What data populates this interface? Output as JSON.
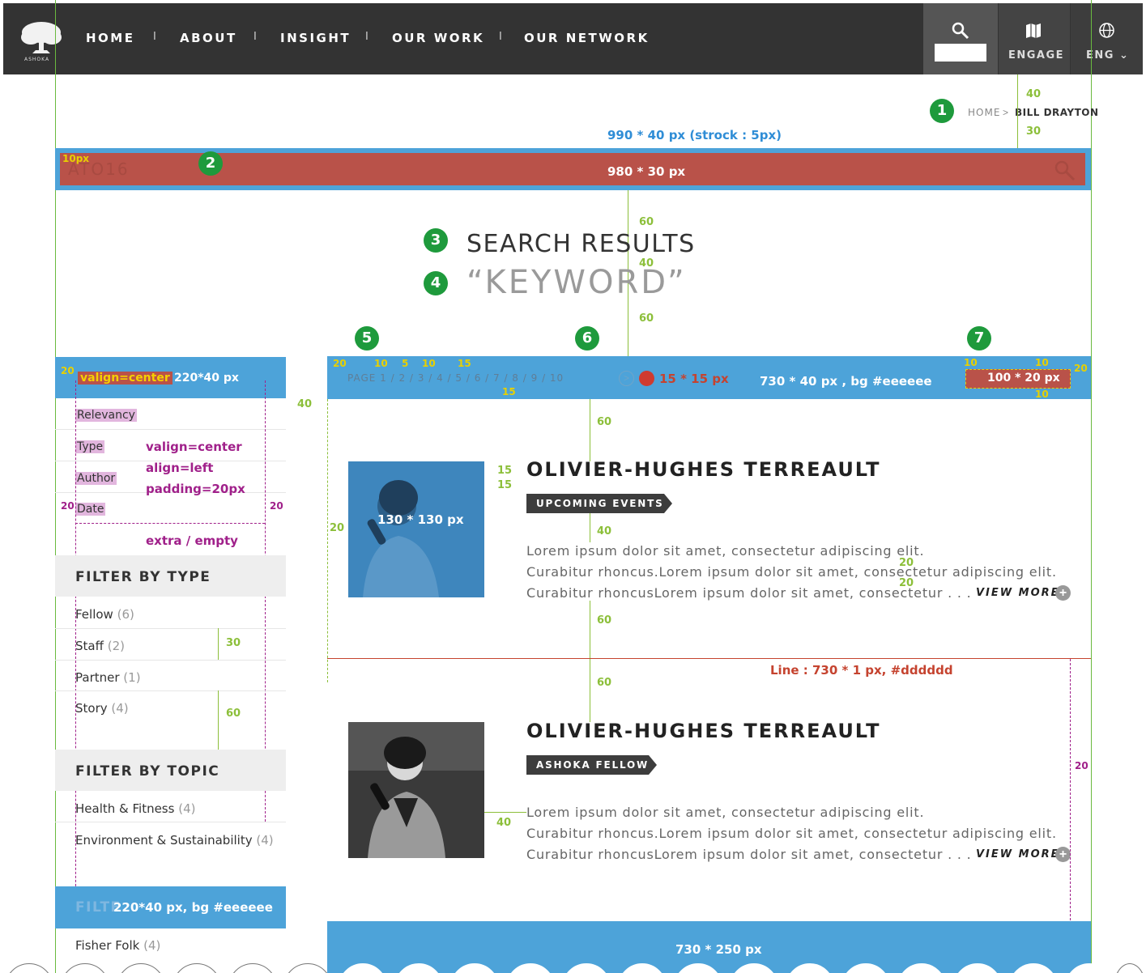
{
  "header": {
    "logo_text": "ASHOKA",
    "nav": [
      "HOME",
      "ABOUT",
      "INSIGHT",
      "OUR WORK",
      "OUR NETWORK"
    ],
    "separator": "I",
    "engage_label": "ENGAGE",
    "lang_label": "ENG"
  },
  "breadcrumb": {
    "home": "HOME",
    "sep": ">",
    "current": "BILL DRAYTON"
  },
  "search": {
    "value": "ATO16"
  },
  "titles": {
    "results": "SEARCH RESULTS",
    "keyword": "“KEYWORD”"
  },
  "badges": [
    "1",
    "2",
    "3",
    "4",
    "5",
    "6",
    "7"
  ],
  "spec_notes": {
    "search_outer": "990 * 40 px (strock : 5px)",
    "search_inner": "980 * 30 px",
    "search_pad": "10px",
    "sidebar_head_valign": "valign=center",
    "sidebar_head_size": "220*40 px",
    "sidebar_rows": [
      "valign=center",
      "align=left",
      "padding=20px"
    ],
    "sidebar_extra": "extra / empty",
    "page_dot": "15 * 15 px",
    "toolbar_size": "730 * 40 px , bg #eeeeee",
    "sort_size": "100 * 20 px",
    "photo_size": "130 * 130 px",
    "line_note": "Line : 730 * 1 px, #dddddd",
    "filter_hover": "220*40 px, bg #eeeeee",
    "bottom_block": "730 * 250 px"
  },
  "spacing": {
    "header_to_bc": "40",
    "bc_to_search": "30",
    "search_to_title": "60",
    "title_gap": "40",
    "title_to_list": "60",
    "sidebar_gap": "40",
    "toolbar_left": "20",
    "pager_gaps": [
      "10",
      "5",
      "10",
      "15"
    ],
    "toolbar_bottom": "15",
    "sort_top": "10",
    "sort_bottom": "10",
    "sort_left": "10",
    "sort_right": "20",
    "sidebar_head_left": "20",
    "card_top": "60",
    "title_gaps": [
      "15",
      "15"
    ],
    "tag_to_text": "40",
    "line_gaps": [
      "20",
      "20"
    ],
    "card_bottom": "60",
    "card2_top": "60",
    "photo_left": "20",
    "text_left2": "40",
    "row_30": "30",
    "row_60": "60",
    "side_20a": "20",
    "side_20b": "20",
    "right_20": "20"
  },
  "sidebar": {
    "sort": [
      "Relevancy",
      "Type",
      "Author",
      "Date"
    ],
    "filter_type": {
      "title": "FILTER BY TYPE",
      "items": [
        {
          "label": "Fellow",
          "count": "(6)"
        },
        {
          "label": "Staff",
          "count": "(2)"
        },
        {
          "label": "Partner",
          "count": "(1)"
        },
        {
          "label": "Story",
          "count": "(4)"
        }
      ]
    },
    "filter_topic": {
      "title": "FILTER BY TOPIC",
      "items": [
        {
          "label": "Health & Fitness",
          "count": "(4)"
        },
        {
          "label": "Environment & Sustainability",
          "count": "(4)"
        }
      ]
    },
    "filter_hover_label": "FILTE",
    "filter_more": [
      {
        "label": "Fisher Folk",
        "count": "(4)"
      }
    ]
  },
  "pager": {
    "text": "PAGE    1 / 2 / 3 / 4 / 5 / 6 / 7 / 8 / 9 / 10",
    "next": ">"
  },
  "results": [
    {
      "name": "OLIVIER-HUGHES TERREAULT",
      "tag": "UPCOMING EVENTS",
      "lines": [
        "Lorem ipsum dolor sit amet, consectetur adipiscing elit.",
        "Curabitur  rhoncus.Lorem  ipsum  dolor  sit  amet,  consectetur  adipiscing  elit.",
        "Curabitur rhoncusLorem ipsum dolor sit amet, consectetur . . ."
      ],
      "view_more": "VIEW MORE"
    },
    {
      "name": "OLIVIER-HUGHES TERREAULT",
      "tag": "ASHOKA FELLOW",
      "lines": [
        "Lorem ipsum dolor sit amet, consectetur adipiscing elit.",
        "Curabitur  rhoncus.Lorem  ipsum  dolor  sit  amet,  consectetur  adipiscing  elit.",
        "Curabitur rhoncusLorem ipsum dolor sit amet, consectetur . . ."
      ],
      "view_more": "VIEW MORE"
    }
  ],
  "colors": {
    "nav_bg": "#333333",
    "annotation_blue": "#4da3d9",
    "search_red": "#b95249",
    "badge_green": "#1e9a3c",
    "filter_bg": "#eeeeee",
    "divider": "#c5432f"
  }
}
